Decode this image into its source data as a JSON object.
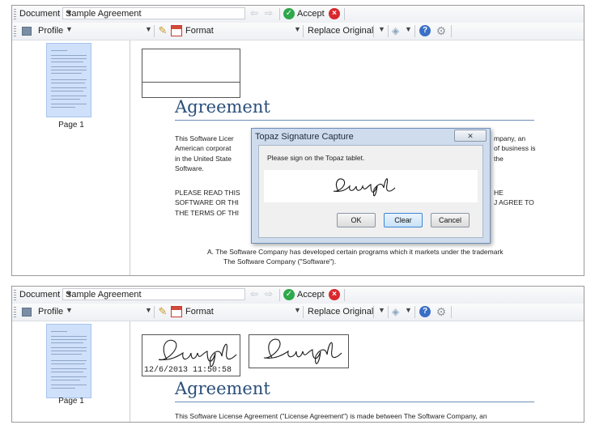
{
  "toolbar": {
    "document_label": "Document",
    "document_value": "Sample Agreement",
    "accept_label": "Accept",
    "profile_label": "Profile",
    "format_label": "Format",
    "replace_label": "Replace Original"
  },
  "thumbnail": {
    "page_label": "Page 1"
  },
  "doc": {
    "title": "Agreement",
    "intro_full": [
      "This Software License Agreement (\"License Agreement\") is made between The Software Company, an"
    ],
    "intro_top": [
      "This Software Licer",
      "American corporat",
      "in the United State",
      "Software."
    ],
    "intro_right": [
      "mpany, an",
      "of business is",
      "the"
    ],
    "please_left": [
      "PLEASE READ THIS",
      "SOFTWARE OR THI",
      "THE TERMS OF THI"
    ],
    "please_right": [
      "HE",
      "J AGREE TO"
    ],
    "item_a": [
      "A.  The Software Company has developed certain programs which it markets under the trademark",
      "The Software Company (\"Software\")."
    ]
  },
  "dialog": {
    "title": "Topaz Signature Capture",
    "message": "Please sign on the Topaz tablet.",
    "ok": "OK",
    "clear": "Clear",
    "cancel": "Cancel"
  },
  "signature": {
    "timestamp": "12/6/2013 11:50:58"
  },
  "icons": [
    "grip-icon",
    "back-arrow-icon",
    "forward-arrow-icon",
    "accept-check-icon",
    "reject-icon",
    "profile-icon",
    "pen-icon",
    "calendar-icon",
    "tag-icon",
    "help-icon",
    "settings-icon",
    "close-icon"
  ]
}
